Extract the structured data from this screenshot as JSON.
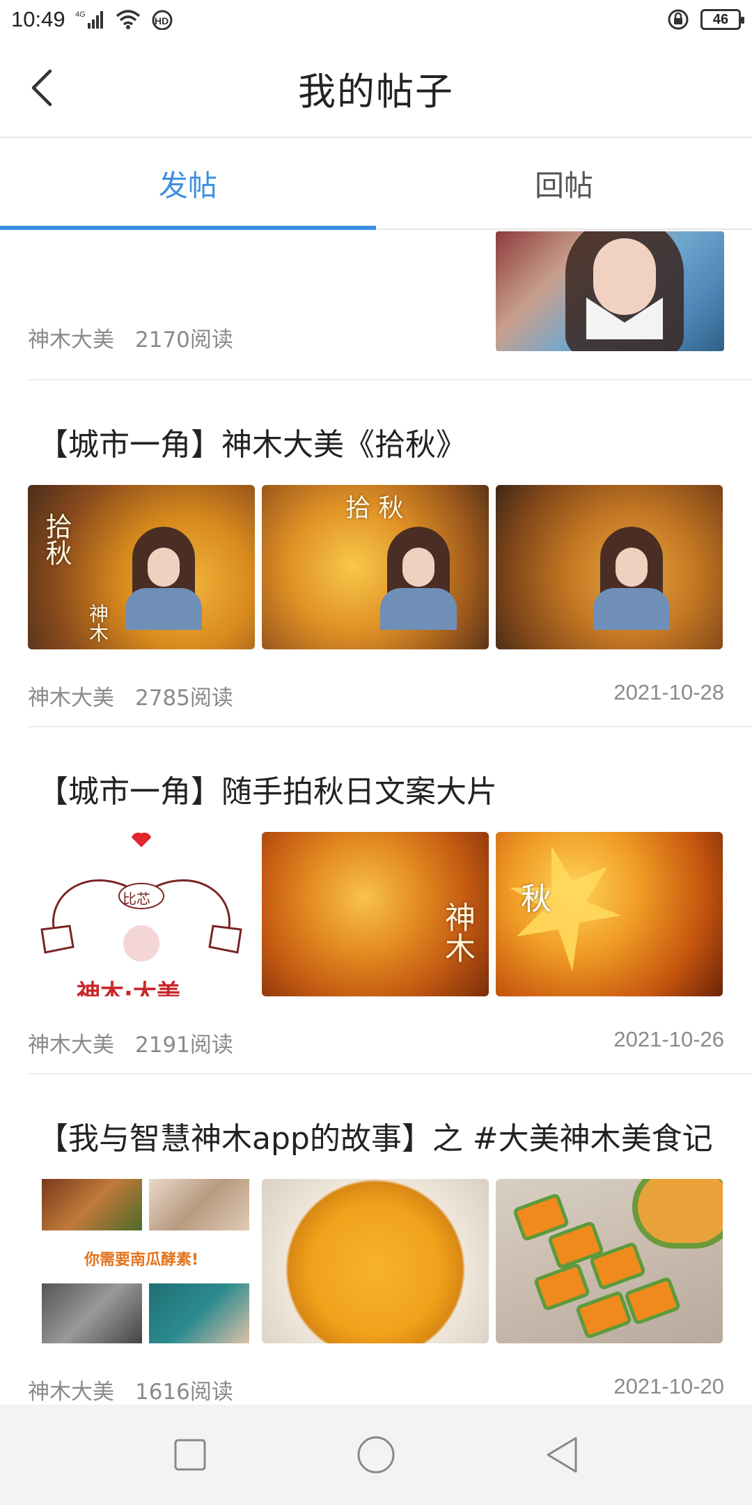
{
  "status_bar": {
    "time": "10:49",
    "network": "4G",
    "hd": "HD",
    "battery": "46"
  },
  "header": {
    "title": "我的帖子"
  },
  "tabs": [
    {
      "label": "发帖",
      "active": true
    },
    {
      "label": "回帖",
      "active": false
    }
  ],
  "accent_color": "#3d8fe0",
  "partial_post": {
    "author": "神木大美",
    "reads": "2170阅读"
  },
  "posts": [
    {
      "title": "【城市一角】神木大美《拾秋》",
      "author": "神木大美",
      "reads": "2785阅读",
      "date": "2021-10-28",
      "image_texts": [
        "拾秋",
        "神木",
        "拾 秋"
      ]
    },
    {
      "title": "【城市一角】随手拍秋日文案大片",
      "author": "神木大美",
      "reads": "2191阅读",
      "date": "2021-10-26",
      "image_texts": [
        "比芯",
        "神木·大美",
        "神木",
        "秋"
      ]
    },
    {
      "title": "【我与智慧神木app的故事】之 #大美神木美食记",
      "author": "神木大美",
      "reads": "1616阅读",
      "date": "2021-10-20",
      "image_texts": [
        "你需要南瓜酵素!"
      ]
    }
  ],
  "nav": {
    "icons": [
      "square-icon",
      "circle-icon",
      "triangle-back-icon"
    ]
  }
}
